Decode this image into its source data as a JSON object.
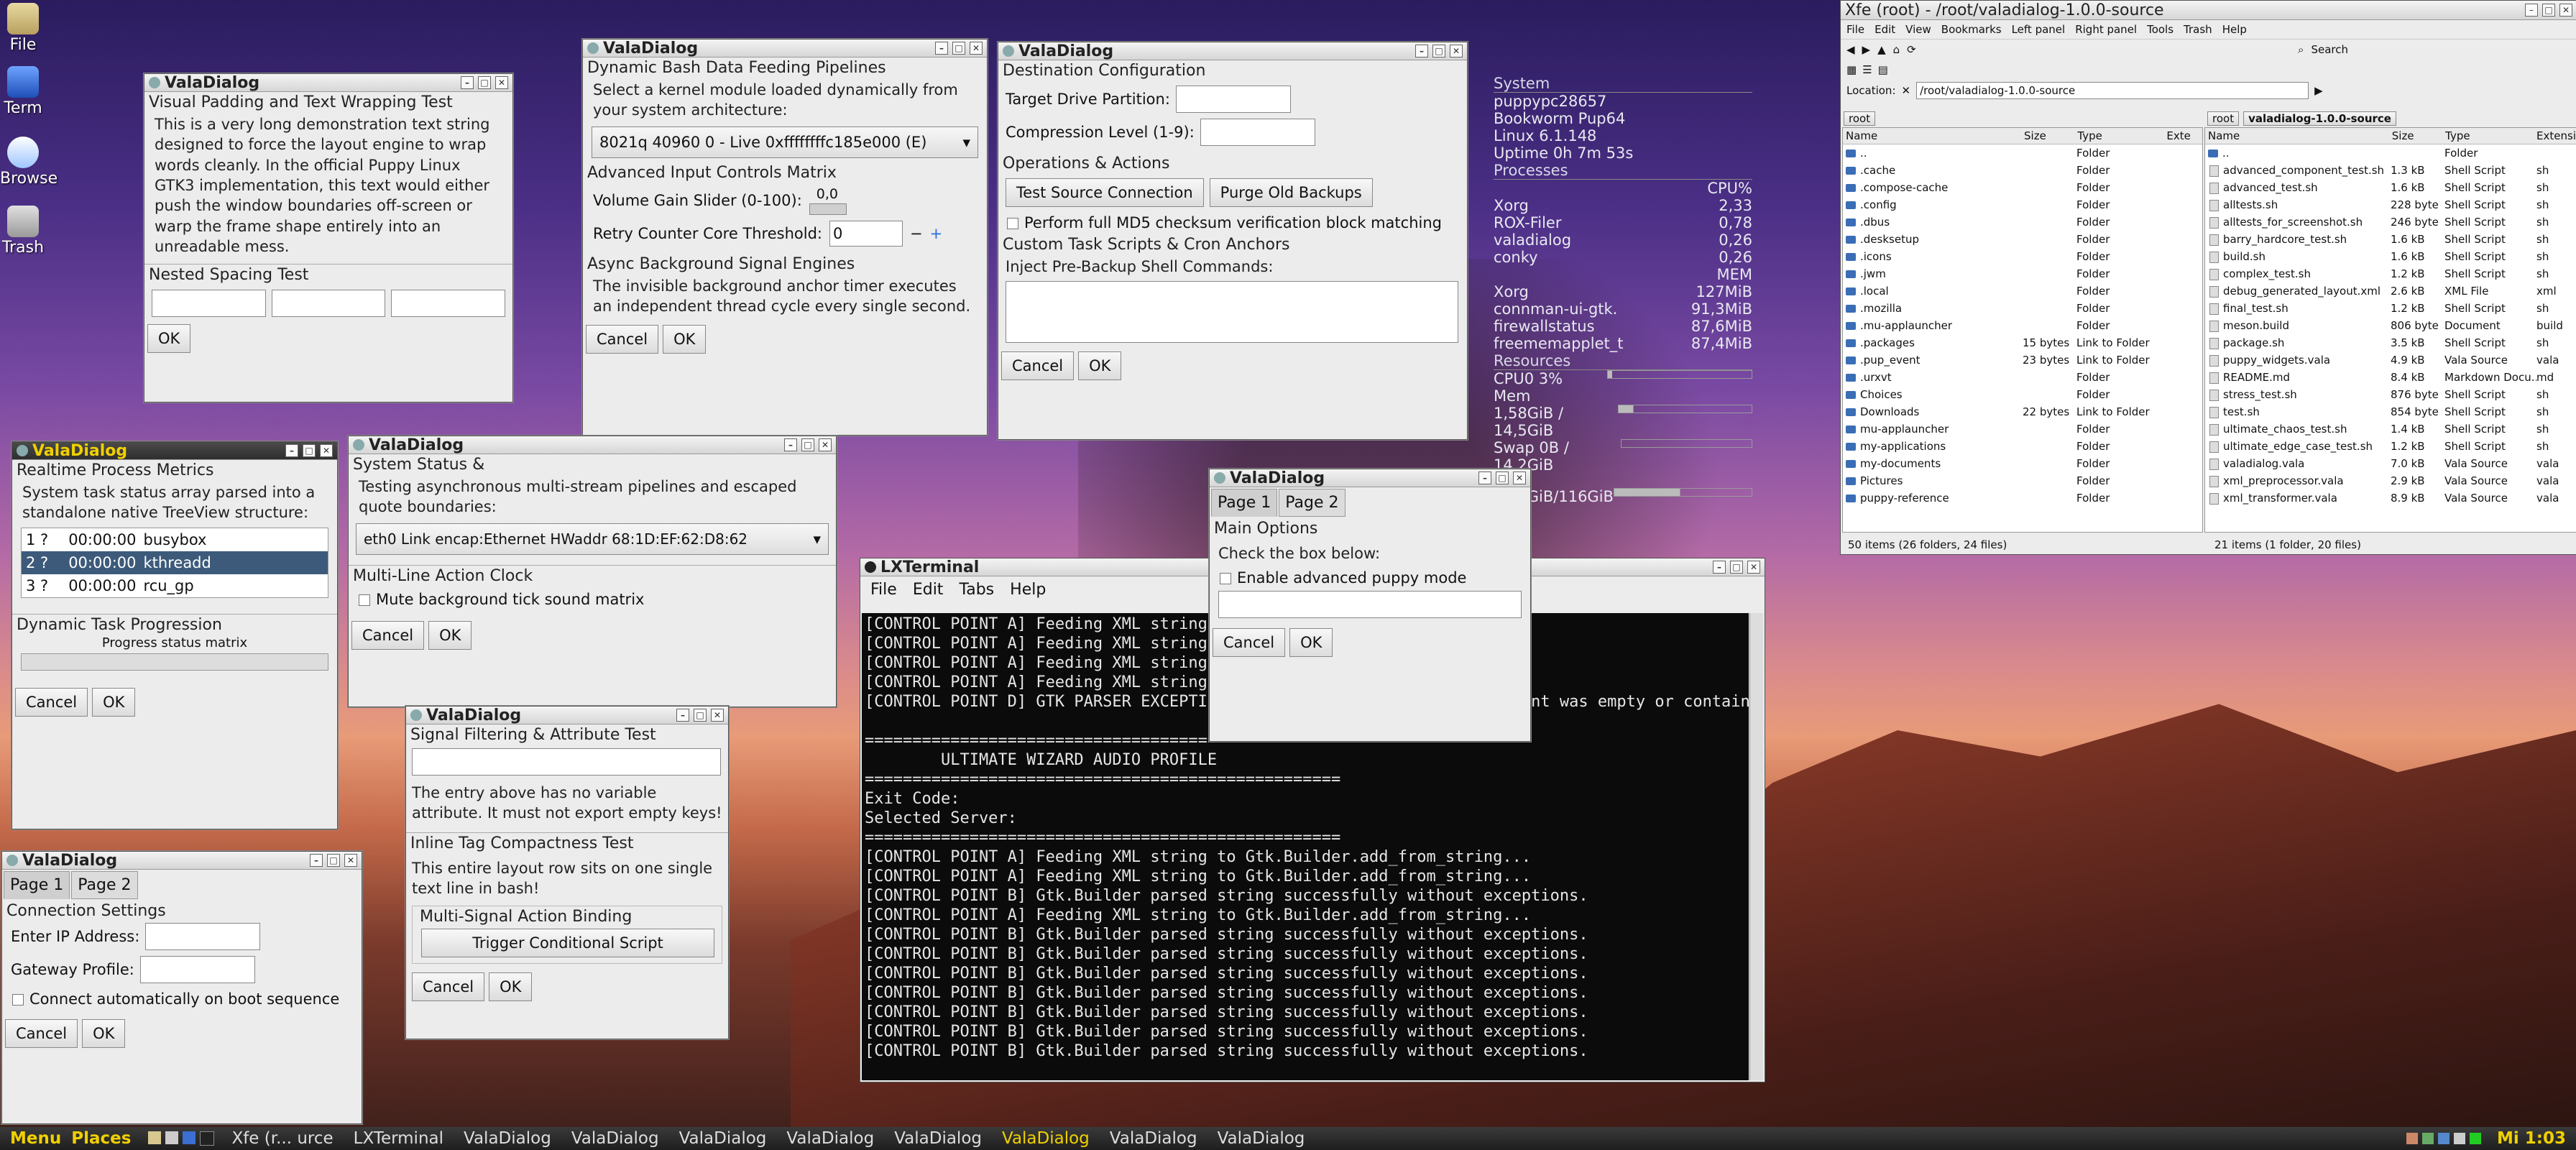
{
  "desktop": {
    "icons": [
      {
        "label": "File",
        "icon": "home-folder-icon"
      },
      {
        "label": "Term",
        "icon": "terminal-icon"
      },
      {
        "label": "Browse",
        "icon": "browser-icon"
      },
      {
        "label": "Trash",
        "icon": "trash-icon"
      }
    ]
  },
  "w_padding": {
    "title": "ValaDialog",
    "section1": "Visual Padding and Text Wrapping Test",
    "body": "This is a very long demonstration text string designed to force the layout engine to wrap words cleanly. In the official Puppy Linux GTK3 implementation, this text would either push the window boundaries off-screen or warp the frame shape entirely into an unreadable mess.",
    "section2": "Nested Spacing Test",
    "ok": "OK"
  },
  "w_bash": {
    "title": "ValaDialog",
    "section1": "Dynamic Bash Data Feeding Pipelines",
    "select_label": "Select a kernel module loaded dynamically from your system architecture:",
    "combo_value": "8021q 40960 0 - Live 0xffffffffc185e000 (E)",
    "section2": "Advanced Input Controls Matrix",
    "slider_label": "Volume Gain Slider (0-100):",
    "slider_value": "0,0",
    "spin_label": "Retry Counter Core Threshold:",
    "spin_value": "0",
    "section3": "Async Background Signal Engines",
    "async_text": "The invisible background anchor timer executes an independent thread cycle every single second.",
    "cancel": "Cancel",
    "ok": "OK"
  },
  "w_dest": {
    "title": "ValaDialog",
    "section1": "Destination Configuration",
    "target_label": "Target Drive Partition:",
    "compression_label": "Compression Level (1-9):",
    "section2": "Operations & Actions",
    "test_btn": "Test Source Connection",
    "purge_btn": "Purge Old Backups",
    "md5_label": "Perform full MD5 checksum verification block matching",
    "section3": "Custom Task Scripts & Cron Anchors",
    "inject_label": "Inject Pre-Backup Shell Commands:",
    "cancel": "Cancel",
    "ok": "OK"
  },
  "conky": {
    "system_hd": "System",
    "hostname": "puppypc28657",
    "distro": "Bookworm Pup64",
    "kernel": "Linux 6.1.148",
    "uptime": "Uptime 0h 7m 53s",
    "processes_hd": "Processes",
    "cpu_hd": "CPU%",
    "cpu_rows": [
      {
        "name": "Xorg",
        "val": "2,33"
      },
      {
        "name": "ROX-Filer",
        "val": "0,78"
      },
      {
        "name": "valadialog",
        "val": "0,26"
      },
      {
        "name": "conky",
        "val": "0,26"
      }
    ],
    "mem_hd": "MEM",
    "mem_rows": [
      {
        "name": "Xorg",
        "val": "127MiB"
      },
      {
        "name": "connman-ui-gtk.",
        "val": "91,3MiB"
      },
      {
        "name": "firewallstatus",
        "val": "87,6MiB"
      },
      {
        "name": "freememapplet_t",
        "val": "87,4MiB"
      }
    ],
    "resources_hd": "Resources",
    "cpu0": "CPU0 3%",
    "cpu0_fill": 0.03,
    "mem_label": "Mem",
    "mem_usage": "1,58GiB / 14,5GiB",
    "mem_fill": 0.11,
    "swap": "Swap 0B / 14,2GiB",
    "swap_fill": 0.0,
    "disk": "55,5GiB/116GiB",
    "disk_fill": 0.48
  },
  "fm": {
    "title": "Xfe (root) - /root/valadialog-1.0.0-source",
    "menu": [
      "File",
      "Edit",
      "View",
      "Bookmarks",
      "Left panel",
      "Right panel",
      "Tools",
      "Trash",
      "Help"
    ],
    "search_label": "Search",
    "location_label": "Location:",
    "location_value": "/root/valadialog-1.0.0-source",
    "left_crumb": "root",
    "right_crumb_root": "root",
    "right_crumb_dir": "valadialog-1.0.0-source",
    "cols_left": [
      "Name",
      "Size",
      "Type",
      "Exte"
    ],
    "cols_right": [
      "Name",
      "Size",
      "Type",
      "Extensi"
    ],
    "left_rows": [
      {
        "name": "..",
        "size": "",
        "type": "Folder"
      },
      {
        "name": ".cache",
        "size": "",
        "type": "Folder"
      },
      {
        "name": ".compose-cache",
        "size": "",
        "type": "Folder"
      },
      {
        "name": ".config",
        "size": "",
        "type": "Folder"
      },
      {
        "name": ".dbus",
        "size": "",
        "type": "Folder"
      },
      {
        "name": ".desksetup",
        "size": "",
        "type": "Folder"
      },
      {
        "name": ".icons",
        "size": "",
        "type": "Folder"
      },
      {
        "name": ".jwm",
        "size": "",
        "type": "Folder"
      },
      {
        "name": ".local",
        "size": "",
        "type": "Folder"
      },
      {
        "name": ".mozilla",
        "size": "",
        "type": "Folder"
      },
      {
        "name": ".mu-applauncher",
        "size": "",
        "type": "Folder"
      },
      {
        "name": ".packages",
        "size": "15 bytes",
        "type": "Link to Folder"
      },
      {
        "name": ".pup_event",
        "size": "23 bytes",
        "type": "Link to Folder"
      },
      {
        "name": ".urxvt",
        "size": "",
        "type": "Folder"
      },
      {
        "name": "Choices",
        "size": "",
        "type": "Folder"
      },
      {
        "name": "Downloads",
        "size": "22 bytes",
        "type": "Link to Folder"
      },
      {
        "name": "mu-applauncher",
        "size": "",
        "type": "Folder"
      },
      {
        "name": "my-applications",
        "size": "",
        "type": "Folder"
      },
      {
        "name": "my-documents",
        "size": "",
        "type": "Folder"
      },
      {
        "name": "Pictures",
        "size": "",
        "type": "Folder"
      },
      {
        "name": "puppy-reference",
        "size": "",
        "type": "Folder"
      }
    ],
    "right_rows": [
      {
        "name": "..",
        "size": "",
        "type": "Folder",
        "ext": ""
      },
      {
        "name": "advanced_component_test.sh",
        "size": "1.3 kB",
        "type": "Shell Script",
        "ext": "sh"
      },
      {
        "name": "advanced_test.sh",
        "size": "1.6 kB",
        "type": "Shell Script",
        "ext": "sh"
      },
      {
        "name": "alltests.sh",
        "size": "228 byte",
        "type": "Shell Script",
        "ext": "sh"
      },
      {
        "name": "alltests_for_screenshot.sh",
        "size": "246 byte",
        "type": "Shell Script",
        "ext": "sh"
      },
      {
        "name": "barry_hardcore_test.sh",
        "size": "1.6 kB",
        "type": "Shell Script",
        "ext": "sh"
      },
      {
        "name": "build.sh",
        "size": "1.6 kB",
        "type": "Shell Script",
        "ext": "sh"
      },
      {
        "name": "complex_test.sh",
        "size": "1.2 kB",
        "type": "Shell Script",
        "ext": "sh"
      },
      {
        "name": "debug_generated_layout.xml",
        "size": "2.6 kB",
        "type": "XML File",
        "ext": "xml"
      },
      {
        "name": "final_test.sh",
        "size": "1.2 kB",
        "type": "Shell Script",
        "ext": "sh"
      },
      {
        "name": "meson.build",
        "size": "806 byte",
        "type": "Document",
        "ext": "build"
      },
      {
        "name": "package.sh",
        "size": "3.5 kB",
        "type": "Shell Script",
        "ext": "sh"
      },
      {
        "name": "puppy_widgets.vala",
        "size": "4.9 kB",
        "type": "Vala Source",
        "ext": "vala"
      },
      {
        "name": "README.md",
        "size": "8.4 kB",
        "type": "Markdown Docu...",
        "ext": "md"
      },
      {
        "name": "stress_test.sh",
        "size": "876 byte",
        "type": "Shell Script",
        "ext": "sh"
      },
      {
        "name": "test.sh",
        "size": "854 byte",
        "type": "Shell Script",
        "ext": "sh"
      },
      {
        "name": "ultimate_chaos_test.sh",
        "size": "1.4 kB",
        "type": "Shell Script",
        "ext": "sh"
      },
      {
        "name": "ultimate_edge_case_test.sh",
        "size": "1.2 kB",
        "type": "Shell Script",
        "ext": "sh"
      },
      {
        "name": "valadialog.vala",
        "size": "7.0 kB",
        "type": "Vala Source",
        "ext": "vala"
      },
      {
        "name": "xml_preprocessor.vala",
        "size": "2.9 kB",
        "type": "Vala Source",
        "ext": "vala"
      },
      {
        "name": "xml_transformer.vala",
        "size": "8.9 kB",
        "type": "Vala Source",
        "ext": "vala"
      }
    ],
    "left_status": "50 items (26 folders, 24 files)",
    "right_status": "21 items (1 folder, 20 files)"
  },
  "w_metrics": {
    "title": "ValaDialog",
    "section1": "Realtime Process Metrics",
    "desc": "System task status array parsed into a standalone native TreeView structure:",
    "rows": [
      {
        "id": "1 ?",
        "time": "00:00:00",
        "name": "busybox"
      },
      {
        "id": "2 ?",
        "time": "00:00:00",
        "name": "kthreadd"
      },
      {
        "id": "3 ?",
        "time": "00:00:00",
        "name": "rcu_gp"
      }
    ],
    "section2": "Dynamic Task Progression",
    "progress_label": "Progress status matrix",
    "progress_fraction": 0.0,
    "cancel": "Cancel",
    "ok": "OK"
  },
  "w_status": {
    "title": "ValaDialog",
    "section1": "System Status &",
    "desc": "Testing asynchronous multi-stream pipelines and escaped quote boundaries:",
    "combo_value": "eth0    Link encap:Ethernet  HWaddr 68:1D:EF:62:D8:62",
    "section2": "Multi-Line Action Clock",
    "mute_label": "Mute background tick sound matrix",
    "cancel": "Cancel",
    "ok": "OK"
  },
  "w_signal": {
    "title": "ValaDialog",
    "section1": "Signal Filtering & Attribute Test",
    "note": "The entry above has no variable attribute. It must not export empty keys!",
    "section2": "Inline Tag Compactness Test",
    "inline_text": "This entire layout row sits on one single text line in bash!",
    "section3": "Multi-Signal Action Binding",
    "trigger": "Trigger Conditional Script",
    "cancel": "Cancel",
    "ok": "OK"
  },
  "w_conn": {
    "title": "ValaDialog",
    "tab1": "Page 1",
    "tab2": "Page 2",
    "section1": "Connection Settings",
    "ip_label": "Enter IP Address:",
    "gw_label": "Gateway Profile:",
    "auto_label": "Connect automatically on boot sequence",
    "cancel": "Cancel",
    "ok": "OK"
  },
  "w_puppy": {
    "title": "ValaDialog",
    "tab1": "Page 1",
    "tab2": "Page 2",
    "section1": "Main Options",
    "check_prompt": "Check the box below:",
    "adv_label": "Enable advanced puppy mode",
    "cancel": "Cancel",
    "ok": "OK"
  },
  "terminal": {
    "title": "LXTerminal",
    "menu": [
      "File",
      "Edit",
      "Tabs",
      "Help"
    ],
    "lines": [
      "[CONTROL POINT A] Feeding XML string to Gtk.Builder.add_from_string...",
      "[CONTROL POINT A] Feeding XML string to Gtk.Builder.add_from_string...",
      "[CONTROL POINT A] Feeding XML string to Gtk.Builder.add_from_string...",
      "[CONTROL POINT A] Feeding XML string to Gtk.Builder.add_from_string...",
      "[CONTROL POINT D] GTK PARSER EXCEPTION: Error on line 1 char 1: Document was empty or contained only whitespace",
      "",
      "==================================================",
      "        ULTIMATE WIZARD AUDIO PROFILE",
      "==================================================",
      "Exit Code:",
      "Selected Server:",
      "==================================================",
      "[CONTROL POINT A] Feeding XML string to Gtk.Builder.add_from_string...",
      "[CONTROL POINT A] Feeding XML string to Gtk.Builder.add_from_string...",
      "[CONTROL POINT B] Gtk.Builder parsed string successfully without exceptions.",
      "[CONTROL POINT A] Feeding XML string to Gtk.Builder.add_from_string...",
      "[CONTROL POINT B] Gtk.Builder parsed string successfully without exceptions.",
      "[CONTROL POINT B] Gtk.Builder parsed string successfully without exceptions.",
      "[CONTROL POINT B] Gtk.Builder parsed string successfully without exceptions.",
      "[CONTROL POINT B] Gtk.Builder parsed string successfully without exceptions.",
      "[CONTROL POINT B] Gtk.Builder parsed string successfully without exceptions.",
      "[CONTROL POINT B] Gtk.Builder parsed string successfully without exceptions.",
      "[CONTROL POINT B] Gtk.Builder parsed string successfully without exceptions."
    ]
  },
  "taskbar": {
    "menu": "Menu",
    "places": "Places",
    "items": [
      {
        "label": "Xfe (r... urce",
        "active": false
      },
      {
        "label": "LXTerminal",
        "active": false
      },
      {
        "label": "ValaDialog",
        "active": false
      },
      {
        "label": "ValaDialog",
        "active": false
      },
      {
        "label": "ValaDialog",
        "active": false
      },
      {
        "label": "ValaDialog",
        "active": false
      },
      {
        "label": "ValaDialog",
        "active": false
      },
      {
        "label": "ValaDialog",
        "active": true
      },
      {
        "label": "ValaDialog",
        "active": false
      },
      {
        "label": "ValaDialog",
        "active": false
      }
    ],
    "clock": "Mi 1:03"
  }
}
